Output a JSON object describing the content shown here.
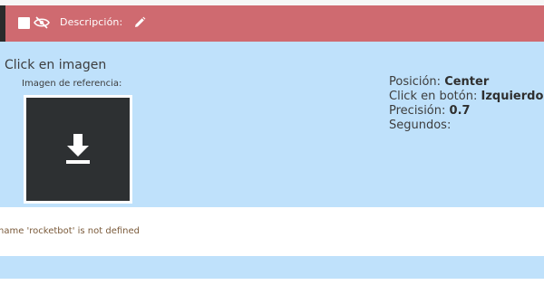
{
  "header": {
    "description_label": "Descripción:",
    "color": "#cf6a70"
  },
  "command": {
    "title": "Click en imagen",
    "reference_label": "Imagen de referencia:",
    "properties": [
      {
        "label": "Posición:",
        "value": "Center"
      },
      {
        "label": "Click en botón:",
        "value": "Izquierdo"
      },
      {
        "label": "Precisión:",
        "value": "0.7"
      },
      {
        "label": "Segundos:",
        "value": ""
      }
    ],
    "body_color": "#bfe1fb"
  },
  "error": {
    "message": "name 'rocketbot' is not defined"
  },
  "icons": {
    "checkbox": "checkbox-icon",
    "hide": "eye-slash-icon",
    "edit": "pencil-icon",
    "reference_image": "download-icon"
  }
}
